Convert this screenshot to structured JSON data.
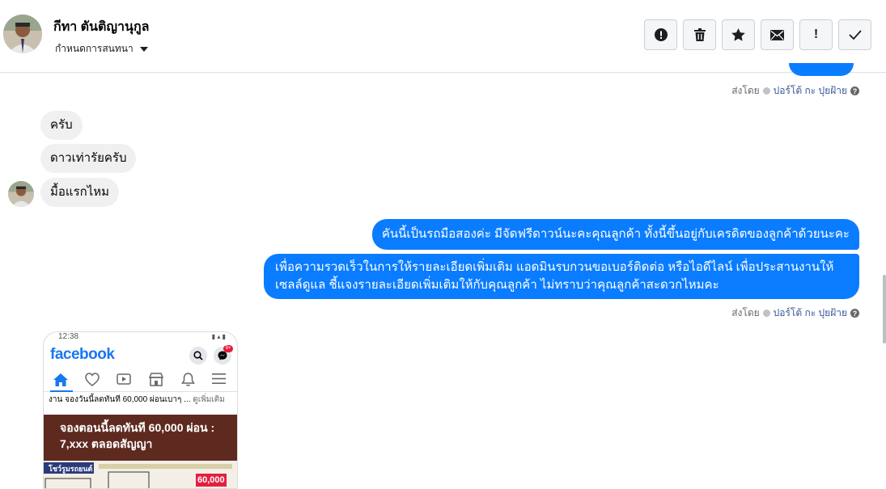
{
  "header": {
    "name": "กีทา ตันติญานุกูล",
    "assign_label": "กำหนดการสนทนา"
  },
  "toolbar": {
    "mark_unread": "!",
    "icons": [
      "alert-circle-icon",
      "trash-icon",
      "star-icon",
      "envelope-icon",
      "exclamation-icon",
      "checkmark-icon"
    ]
  },
  "sent_info": {
    "prefix": "ส่งโดย",
    "sender": "ปอร์โต้ กะ ปุยฝ้าย",
    "help": "?"
  },
  "incoming": [
    {
      "text": "ครับ"
    },
    {
      "text": "ดาวเท่ารัยครับ"
    },
    {
      "text": "มื้อแรกไหม"
    }
  ],
  "outgoing": [
    {
      "text": "คันนี้เป็นรถมือสองค่ะ มีจัดฟรีดาวน์นะคะคุณลูกค้า ทั้งนี้ขึ้นอยู่กับเครดิตของลูกค้าด้วยนะคะ"
    },
    {
      "text": "เพื่อความรวดเร็วในการให้รายละเอียดเพิ่มเติม แอดมินรบกวนขอเบอร์ติดต่อ หรือไอดีไลน์ เพื่อประสานงานให้เซลล์ดูแล ชี้แจงรายละเอียดเพิ่มเติมให้กับคุณลูกค้า ไม่ทราบว่าคุณลูกค้าสะดวกไหมคะ"
    }
  ],
  "attachment": {
    "status_time": "12:38",
    "app_name": "facebook",
    "messenger_badge": "9+",
    "post_text": "งาน จองวันนี้ลดทันที 60,000 ผ่อนเบาๆ ...",
    "post_more": "ดูเพิ่มเติม",
    "banner_line1": "จองตอนนี้ลดทันที 60,000 ผ่อน :",
    "banner_line2": "7,xxx ตลอดสัญญา",
    "flyer_left": "โชว์รูมรถยนต์",
    "flyer_price": "60,000"
  },
  "colors": {
    "outgoing_bubble": "#0a7cff",
    "incoming_bubble": "#f0f0f0",
    "fb_blue": "#1877f2"
  }
}
